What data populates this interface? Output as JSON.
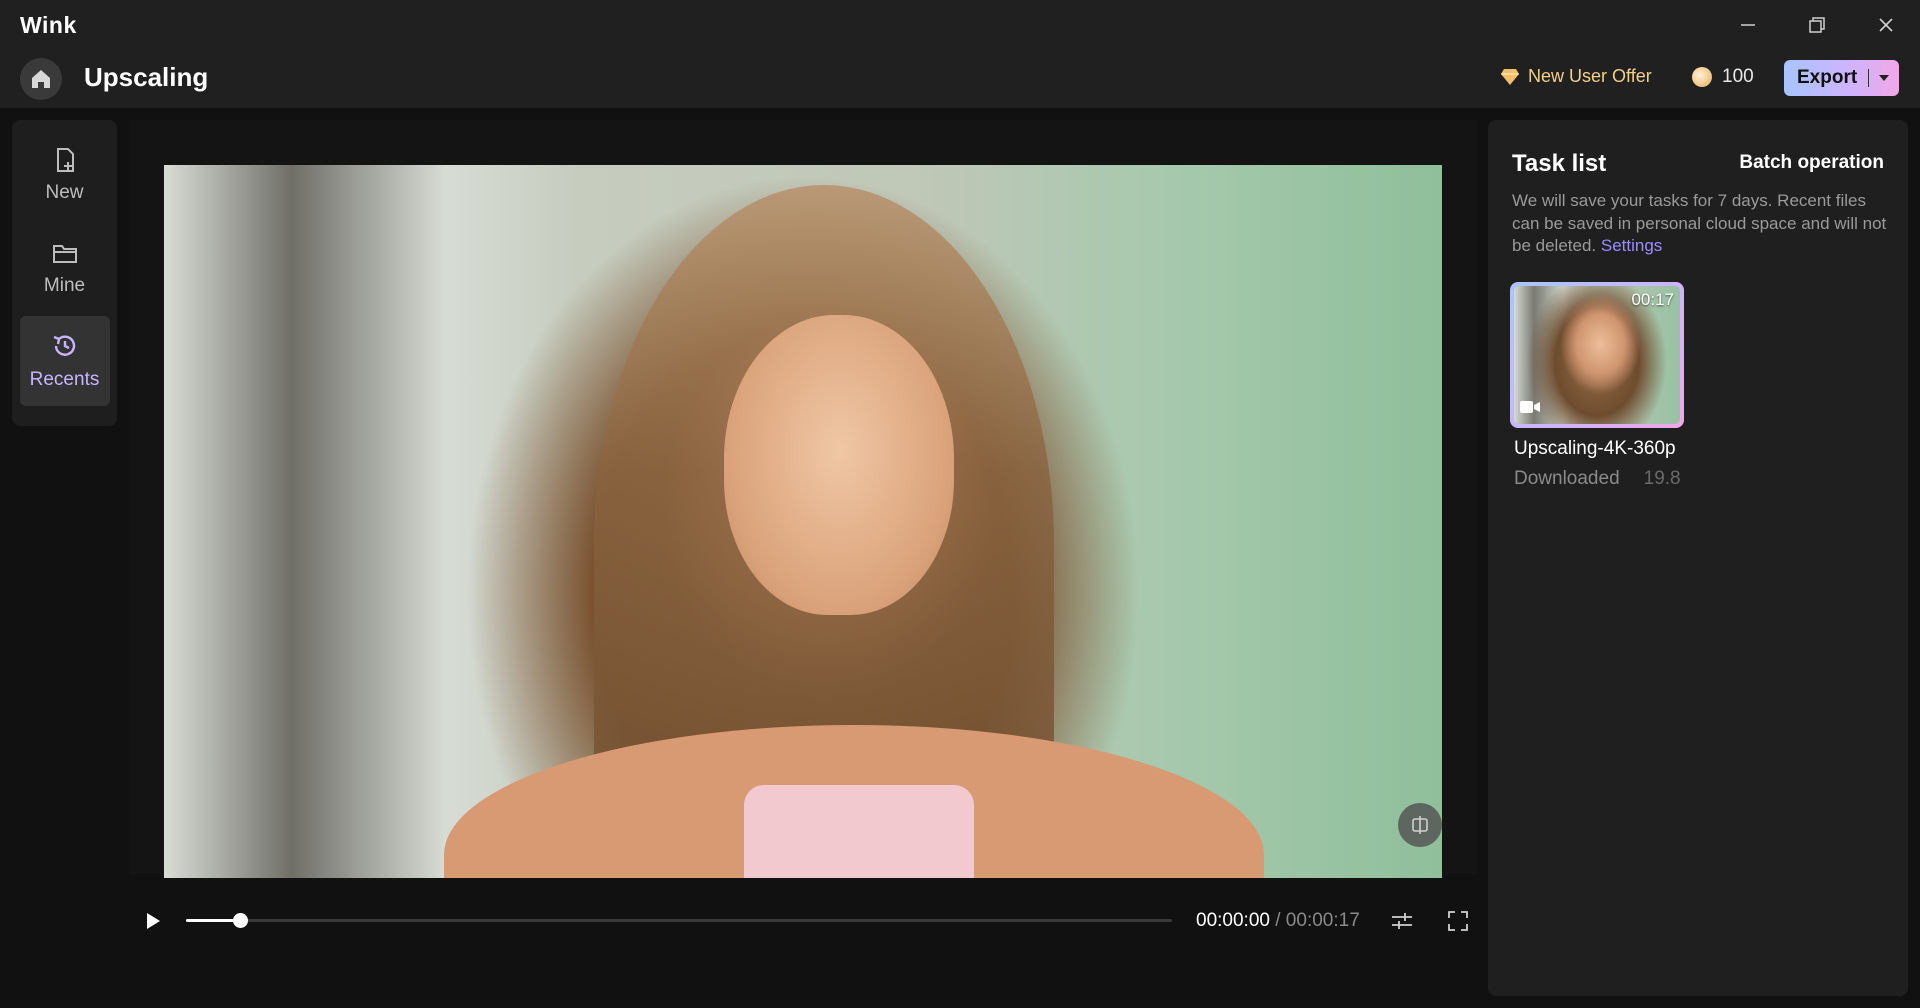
{
  "app": {
    "brand": "Wink",
    "page_title": "Upscaling"
  },
  "header": {
    "offer_label": "New User Offer",
    "credits": "100",
    "export_label": "Export"
  },
  "nav": {
    "items": [
      {
        "label": "New",
        "icon": "new-file-icon"
      },
      {
        "label": "Mine",
        "icon": "folder-icon"
      },
      {
        "label": "Recents",
        "icon": "recents-icon",
        "active": true
      }
    ]
  },
  "player": {
    "current_time": "00:00:00",
    "total_time": "/ 00:00:17",
    "progress": 0.055
  },
  "task_list": {
    "title": "Task list",
    "batch_label": "Batch operation",
    "description": "We will save your tasks for 7 days. Recent files can be saved in personal cloud space and will not be deleted.",
    "settings_link": "Settings",
    "tasks": [
      {
        "name": "Upscaling-4K-360p",
        "duration": "00:17",
        "status": "Downloaded",
        "size": "19.8"
      }
    ]
  },
  "colors": {
    "accent": "#c6b5ff",
    "link": "#9c8cff",
    "offer": "#f3d08a"
  }
}
